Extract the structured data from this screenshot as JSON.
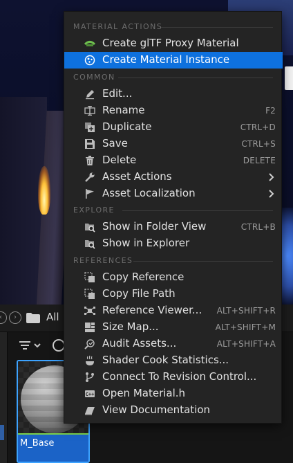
{
  "menu": {
    "sections": [
      {
        "label": "MATERIAL ACTIONS",
        "items": [
          {
            "label": "Create glTF Proxy Material",
            "icon": "gltf-icon",
            "shortcut": ""
          },
          {
            "label": "Create Material Instance",
            "icon": "material-instance-icon",
            "shortcut": "",
            "highlighted": true
          }
        ]
      },
      {
        "label": "COMMON",
        "items": [
          {
            "label": "Edit...",
            "icon": "edit-icon",
            "shortcut": ""
          },
          {
            "label": "Rename",
            "icon": "rename-icon",
            "shortcut": "F2"
          },
          {
            "label": "Duplicate",
            "icon": "duplicate-icon",
            "shortcut": "CTRL+D"
          },
          {
            "label": "Save",
            "icon": "save-icon",
            "shortcut": "CTRL+S"
          },
          {
            "label": "Delete",
            "icon": "delete-icon",
            "shortcut": "DELETE"
          },
          {
            "label": "Asset Actions",
            "icon": "wrench-icon",
            "shortcut": "",
            "submenu": true
          },
          {
            "label": "Asset Localization",
            "icon": "flag-icon",
            "shortcut": "",
            "submenu": true
          }
        ]
      },
      {
        "label": "EXPLORE",
        "items": [
          {
            "label": "Show in Folder View",
            "icon": "folder-search-icon",
            "shortcut": "CTRL+B"
          },
          {
            "label": "Show in Explorer",
            "icon": "explorer-search-icon",
            "shortcut": ""
          }
        ]
      },
      {
        "label": "REFERENCES",
        "items": [
          {
            "label": "Copy Reference",
            "icon": "copy-reference-icon",
            "shortcut": ""
          },
          {
            "label": "Copy File Path",
            "icon": "copy-path-icon",
            "shortcut": ""
          },
          {
            "label": "Reference Viewer...",
            "icon": "reference-viewer-icon",
            "shortcut": "ALT+SHIFT+R"
          },
          {
            "label": "Size Map...",
            "icon": "size-map-icon",
            "shortcut": "ALT+SHIFT+M"
          },
          {
            "label": "Audit Assets...",
            "icon": "audit-icon",
            "shortcut": "ALT+SHIFT+A"
          },
          {
            "label": "Shader Cook Statistics...",
            "icon": "shader-icon",
            "shortcut": ""
          },
          {
            "label": "Connect To Revision Control...",
            "icon": "revision-control-icon",
            "shortcut": ""
          },
          {
            "label": "Open Material.h",
            "icon": "code-icon",
            "shortcut": ""
          },
          {
            "label": "View Documentation",
            "icon": "documentation-icon",
            "shortcut": ""
          }
        ]
      }
    ]
  },
  "content_browser": {
    "path_label": "All",
    "asset_name": "M_Base"
  },
  "colors": {
    "menu_bg": "#242424",
    "highlight": "#0e71de",
    "section_text": "#6e6e6e",
    "item_text": "#e2e2e2",
    "shortcut_text": "#9c9c9c",
    "asset_selected": "#1b63c7"
  }
}
